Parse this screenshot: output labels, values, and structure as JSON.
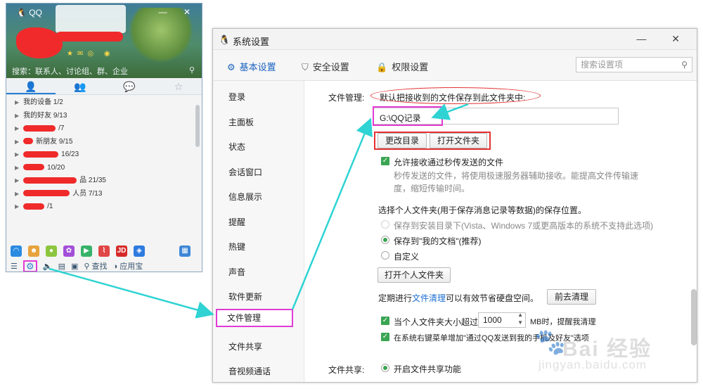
{
  "qq_panel": {
    "title": "QQ",
    "window_controls": "— ✕",
    "status_icons": "★✉◎ ◉",
    "search_placeholder": "搜索：联系人、讨论组、群、企业",
    "tabs": [
      "contacts",
      "groups",
      "chat",
      "favorites"
    ],
    "groups": [
      {
        "label": "我的设备 1/2"
      },
      {
        "label": "我的好友 9/13"
      },
      {
        "label": "/7"
      },
      {
        "label": "新朋友 9/15"
      },
      {
        "label": "16/23"
      },
      {
        "label": "10/20"
      },
      {
        "label": "品 21/35"
      },
      {
        "label": "人员 7/13"
      },
      {
        "label": "/1"
      }
    ],
    "bottom": {
      "search_label": "查找",
      "apps_label": "应用宝"
    }
  },
  "window": {
    "title": "系统设置",
    "controls": "— ✕",
    "toolbar": {
      "basic": "基本设置",
      "security": "安全设置",
      "permission": "权限设置"
    },
    "search_placeholder": "搜索设置项",
    "nav": [
      "登录",
      "主面板",
      "状态",
      "会话窗口",
      "信息展示",
      "提醒",
      "热键",
      "声音",
      "软件更新",
      "文件管理",
      "文件共享",
      "音视频通话"
    ],
    "active_nav": "文件管理"
  },
  "file_mgmt": {
    "section_label": "文件管理:",
    "save_hint": "默认把接收到的文件保存到此文件夹中:",
    "path_value": "G:\\QQ记录",
    "change_dir_btn": "更改目录",
    "open_folder_btn": "打开文件夹",
    "allow_fast_label": "允许接收通过秒传发送的文件",
    "allow_fast_desc_1": "秒传发送的文件，将使用极速服务器辅助接收。能提高文件传输速",
    "allow_fast_desc_2": "度，缩短传输时间。",
    "personal_folder_label": "选择个人文件夹(用于保存消息记录等数据)的保存位置。",
    "opt_install_dir": "保存到安装目录下(Vista、Windows 7或更高版本的系统不支持此选项)",
    "opt_my_docs": "保存到\"我的文档\"(推荐)",
    "opt_custom": "自定义",
    "open_personal_btn": "打开个人文件夹",
    "cleanup_prefix": "定期进行",
    "cleanup_link": "文件清理",
    "cleanup_suffix": "可以有效节省硬盘空间。",
    "cleanup_btn": "前去清理",
    "size_limit_prefix": "当个人文件夹大小超过",
    "size_limit_value": "1000",
    "size_limit_suffix": "MB时，提醒我清理",
    "context_menu_label": "在系统右键菜单增加\"通过QQ发送到我的手机及好友\"选项"
  },
  "file_share": {
    "section_label": "文件共享:",
    "enable_label": "开启文件共享功能"
  },
  "watermark": {
    "brand": "Bai 经验",
    "url": "jingyan.baidu.com"
  },
  "colors": {
    "highlight_magenta": "#e23bd6",
    "highlight_red": "#e33131",
    "arrow_cyan": "#2fd3d3",
    "accent_blue": "#1c63c0",
    "check_green": "#3aa552"
  }
}
